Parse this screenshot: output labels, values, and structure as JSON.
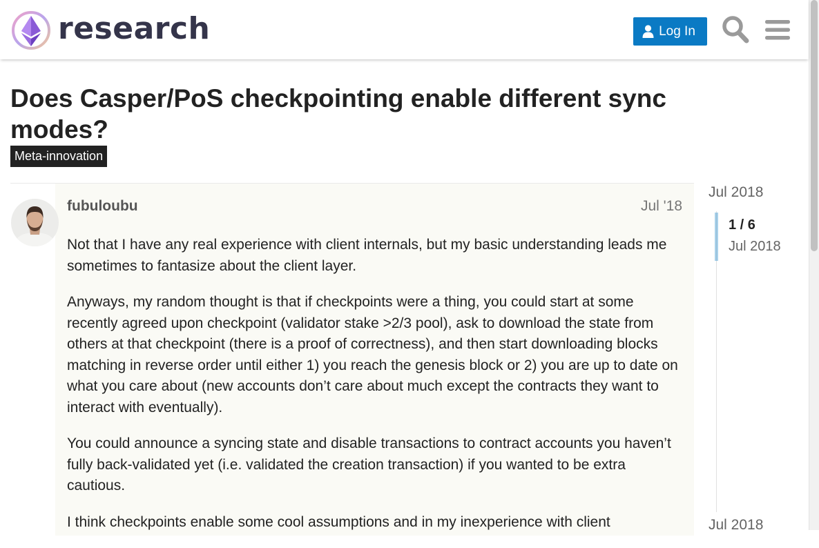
{
  "header": {
    "site_name": "research",
    "login_label": "Log In",
    "icons": [
      "logo-icon",
      "user-icon",
      "search-icon",
      "hamburger-menu-icon"
    ]
  },
  "topic": {
    "title": "Does Casper/PoS checkpointing enable different sync modes?",
    "category": "Meta-innovation"
  },
  "post": {
    "username": "fubuloubu",
    "date": "Jul '18",
    "paragraphs": [
      "Not that I have any real experience with client internals, but my basic understanding leads me sometimes to fantasize about the client layer.",
      "Anyways, my random thought is that if checkpoints were a thing, you could start at some recently agreed upon checkpoint (validator stake >2/3 pool), ask to download the state from others at that checkpoint (there is a proof of correctness), and then start downloading blocks matching in reverse order until either 1) you reach the genesis block or 2) you are up to date on what you care about (new accounts don’t care about much except the contracts they want to interact with eventually).",
      "You could announce a syncing state and disable transactions to contract accounts you haven’t fully back-validated yet (i.e. validated the creation transaction) if you wanted to be extra cautious.",
      "I think checkpoints enable some cool assumptions and in my inexperience with client"
    ]
  },
  "timeline": {
    "start_date": "Jul 2018",
    "position": "1 / 6",
    "position_date": "Jul 2018",
    "end_date": "Jul 2018"
  },
  "colors": {
    "primary": "#0a7ac4",
    "category_badge": "#222222",
    "post_background": "#fafaf5"
  }
}
